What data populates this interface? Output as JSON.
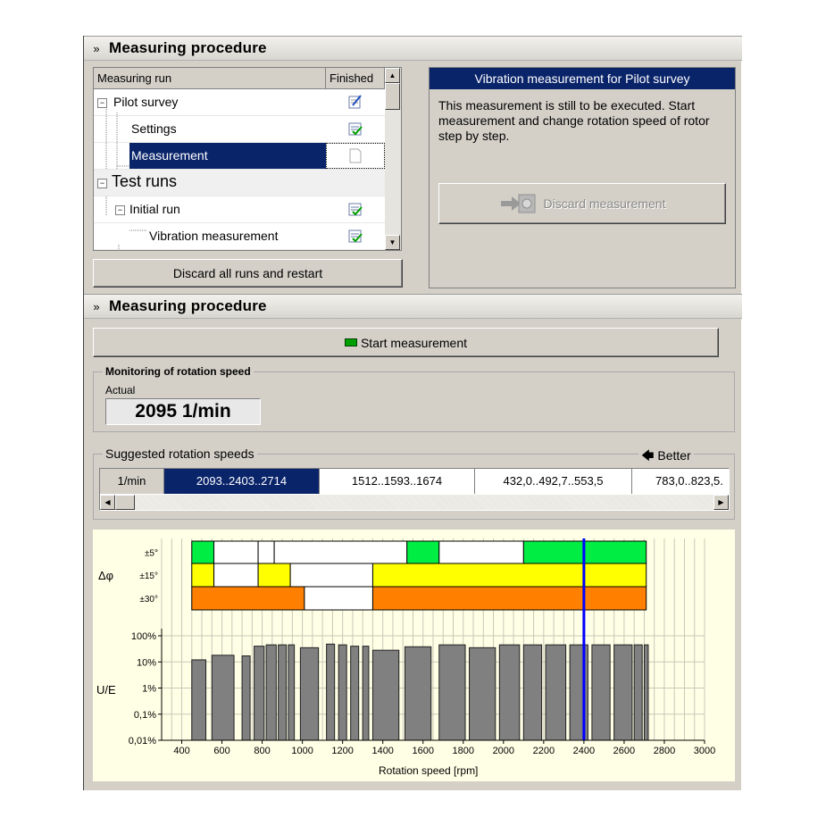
{
  "section1": {
    "title": "Measuring procedure",
    "tree": {
      "col_run": "Measuring run",
      "col_finished": "Finished",
      "rows": [
        {
          "label": "Pilot survey",
          "icon": "pencil-check-icon"
        },
        {
          "label": "Settings",
          "icon": "checklist-icon"
        },
        {
          "label": "Measurement",
          "icon": "blank-doc-icon"
        },
        {
          "label": "Test runs",
          "icon": ""
        },
        {
          "label": "Initial run",
          "icon": "checklist-icon"
        },
        {
          "label": "Vibration measurement",
          "icon": "checklist-icon"
        }
      ]
    },
    "discard_all_label": "Discard all runs and restart",
    "info_panel": {
      "title": "Vibration measurement for Pilot survey",
      "text": "This measurement is still to be executed. Start measurement and change rotation speed of rotor step by step.",
      "discard_label": "Discard measurement"
    }
  },
  "section2": {
    "title": "Measuring procedure",
    "start_label": "Start measurement",
    "monitoring": {
      "title": "Monitoring of rotation speed",
      "actual_label": "Actual",
      "actual_value": "2095 1/min"
    },
    "suggested": {
      "title": "Suggested rotation speeds",
      "better_label": "Better",
      "unit": "1/min",
      "values": [
        "2093..2403..2714",
        "1512..1593..1674",
        "432,0..492,7..553,5",
        "783,0..823,5."
      ]
    }
  },
  "chart_data": {
    "type": "bar",
    "xlabel": "Rotation speed [rpm]",
    "xlim": [
      300,
      3000
    ],
    "xticks": [
      400,
      600,
      800,
      1000,
      1200,
      1400,
      1600,
      1800,
      2000,
      2200,
      2400,
      2600,
      2800,
      3000
    ],
    "ylabel": "U/E",
    "yscale": "log",
    "yticks": [
      "0,01%",
      "0,1%",
      "1%",
      "10%",
      "100%"
    ],
    "phase_label": "Δφ",
    "phase_bands": [
      "±5°",
      "±15°",
      "±30°"
    ],
    "current_speed": 2400,
    "phase_segments": {
      "±5°": [
        [
          450,
          560,
          "green"
        ],
        [
          560,
          780,
          "white"
        ],
        [
          780,
          860,
          "white"
        ],
        [
          860,
          1520,
          "white"
        ],
        [
          1520,
          1680,
          "green"
        ],
        [
          1680,
          2100,
          "white"
        ],
        [
          2100,
          2400,
          "green"
        ],
        [
          2400,
          2710,
          "green"
        ]
      ],
      "±15°": [
        [
          450,
          560,
          "yellow"
        ],
        [
          560,
          780,
          "white"
        ],
        [
          780,
          940,
          "yellow"
        ],
        [
          940,
          1350,
          "white"
        ],
        [
          1350,
          2710,
          "yellow"
        ]
      ],
      "±30°": [
        [
          450,
          1010,
          "orange"
        ],
        [
          1010,
          1350,
          "white"
        ],
        [
          1350,
          2710,
          "orange"
        ]
      ]
    },
    "bars": [
      {
        "x0": 450,
        "x1": 520,
        "v": 12
      },
      {
        "x0": 550,
        "x1": 660,
        "v": 18
      },
      {
        "x0": 700,
        "x1": 740,
        "v": 17
      },
      {
        "x0": 760,
        "x1": 810,
        "v": 40
      },
      {
        "x0": 820,
        "x1": 870,
        "v": 45
      },
      {
        "x0": 880,
        "x1": 920,
        "v": 45
      },
      {
        "x0": 930,
        "x1": 960,
        "v": 45
      },
      {
        "x0": 990,
        "x1": 1080,
        "v": 35
      },
      {
        "x0": 1120,
        "x1": 1160,
        "v": 48
      },
      {
        "x0": 1180,
        "x1": 1220,
        "v": 45
      },
      {
        "x0": 1240,
        "x1": 1280,
        "v": 40
      },
      {
        "x0": 1300,
        "x1": 1330,
        "v": 40
      },
      {
        "x0": 1350,
        "x1": 1480,
        "v": 28
      },
      {
        "x0": 1510,
        "x1": 1640,
        "v": 38
      },
      {
        "x0": 1680,
        "x1": 1810,
        "v": 45
      },
      {
        "x0": 1830,
        "x1": 1960,
        "v": 35
      },
      {
        "x0": 1980,
        "x1": 2080,
        "v": 45
      },
      {
        "x0": 2100,
        "x1": 2190,
        "v": 45
      },
      {
        "x0": 2210,
        "x1": 2310,
        "v": 45
      },
      {
        "x0": 2330,
        "x1": 2420,
        "v": 45
      },
      {
        "x0": 2440,
        "x1": 2530,
        "v": 45
      },
      {
        "x0": 2550,
        "x1": 2640,
        "v": 45
      },
      {
        "x0": 2650,
        "x1": 2690,
        "v": 45
      },
      {
        "x0": 2700,
        "x1": 2720,
        "v": 45
      }
    ],
    "colors": {
      "green": "#00ee44",
      "yellow": "#ffff00",
      "orange": "#ff7f00",
      "white": "#ffffff",
      "bar": "#808080",
      "marker": "#0000ff"
    }
  }
}
